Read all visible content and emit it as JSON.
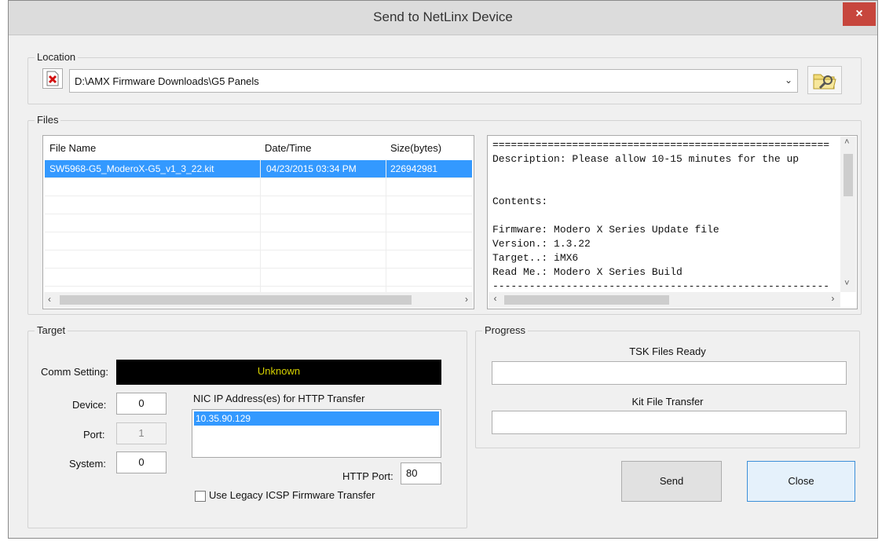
{
  "window": {
    "title": "Send to NetLinx Device",
    "close_glyph": "×"
  },
  "location": {
    "group_label": "Location",
    "path_value": "D:\\AMX Firmware Downloads\\G5 Panels",
    "left_icon": "file-delete-icon",
    "folder_icon": "browse-folder-icon"
  },
  "files": {
    "group_label": "Files",
    "columns": [
      "File Name",
      "Date/Time",
      "Size(bytes)"
    ],
    "rows": [
      {
        "name": "SW5968-G5_ModeroX-G5_v1_3_22.kit",
        "datetime": "04/23/2015  03:34 PM",
        "size": "226942981",
        "selected": true
      }
    ],
    "details_lines": [
      "=======================================================",
      "Description: Please allow 10-15 minutes for the up",
      "",
      "",
      "Contents:",
      "",
      "Firmware: Modero X Series Update file",
      "Version.: 1.3.22",
      "Target..: iMX6",
      "Read Me.: Modero X Series Build",
      "-------------------------------------------------------"
    ]
  },
  "target": {
    "group_label": "Target",
    "comm_setting_label": "Comm Setting:",
    "comm_setting_value": "Unknown",
    "device_label": "Device:",
    "device_value": "0",
    "port_label": "Port:",
    "port_value": "1",
    "system_label": "System:",
    "system_value": "0",
    "nic_label": "NIC IP Address(es) for HTTP Transfer",
    "nic_items": [
      "10.35.90.129"
    ],
    "http_port_label": "HTTP Port:",
    "http_port_value": "80",
    "legacy_label": "Use Legacy ICSP Firmware Transfer",
    "legacy_checked": false
  },
  "progress": {
    "group_label": "Progress",
    "tsk_label": "TSK Files Ready",
    "tsk_progress": 0,
    "kit_label": "Kit File Transfer",
    "kit_progress": 0
  },
  "buttons": {
    "send": "Send",
    "close": "Close"
  },
  "colors": {
    "selection": "#3399ff",
    "comm_bg": "#000000",
    "comm_text": "#d6d100",
    "close_red": "#c7463d"
  }
}
